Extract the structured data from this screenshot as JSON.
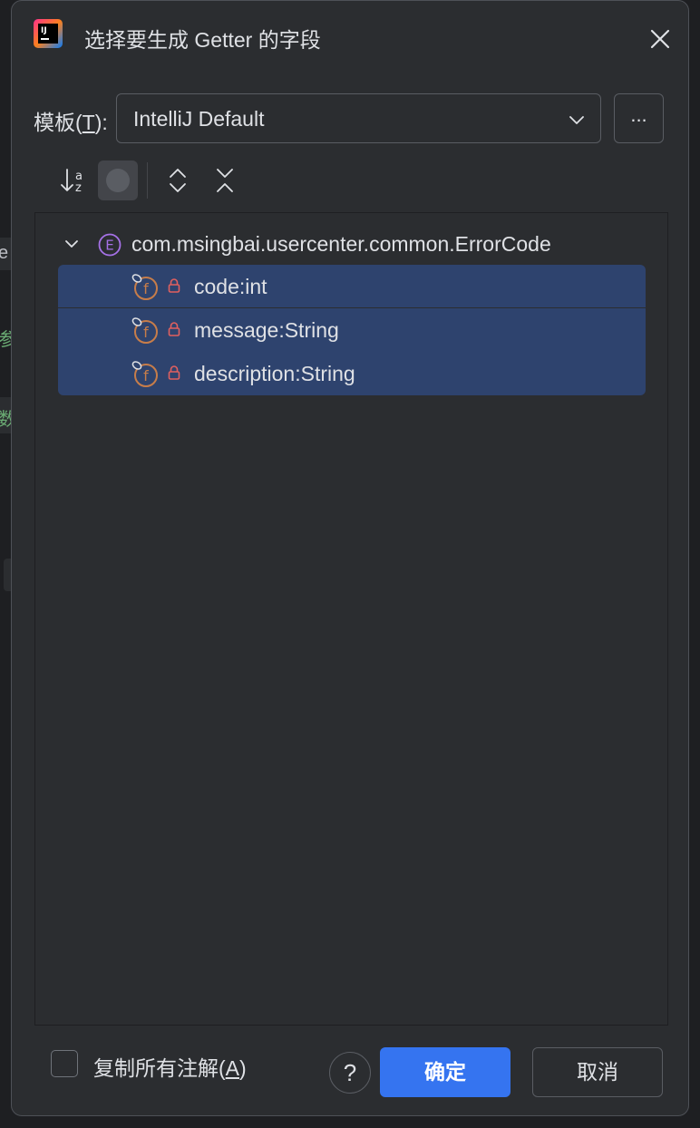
{
  "background": {
    "fragments": [
      "e",
      "参",
      "数"
    ]
  },
  "dialog": {
    "title": "选择要生成 Getter 的字段",
    "app_icon_text": "IJ",
    "template": {
      "label": "模板(",
      "label_mnemonic": "T",
      "label_end": "):",
      "selected": "IntelliJ Default",
      "more_label": "..."
    },
    "tree": {
      "root": "com.msingbai.usercenter.common.ErrorCode",
      "fields": [
        {
          "label": "code:int"
        },
        {
          "label": "message:String"
        },
        {
          "label": "description:String"
        }
      ]
    },
    "footer": {
      "copy_annotations_label": "复制所有注解(",
      "copy_annotations_mnemonic": "A",
      "copy_annotations_end": ")",
      "help_label": "?",
      "ok_label": "确定",
      "cancel_label": "取消"
    }
  },
  "colors": {
    "accent": "#3574f0",
    "selection": "#2e436e",
    "field_icon": "#c77d4a",
    "class_icon": "#a571e6",
    "lock": "#e0605f"
  }
}
